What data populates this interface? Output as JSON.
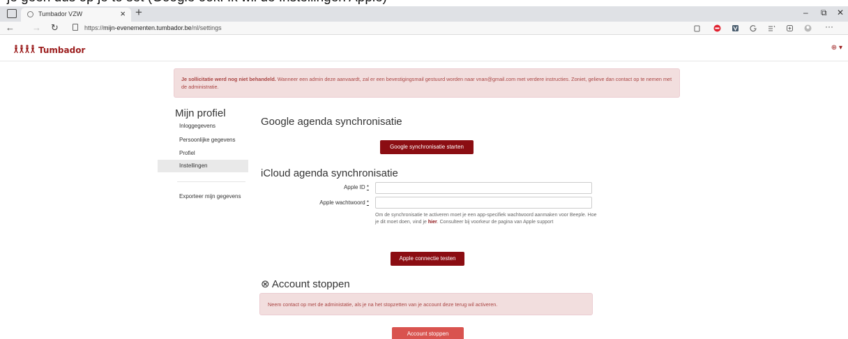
{
  "doc_overlay_text": "je geen dus op je to set (Google ook: Ik wil de Instellingen Apple)",
  "browser": {
    "tab_title": "Tumbador VZW",
    "url_prefix": "https://",
    "url_host": "mijn-evenementen.tumbador.be",
    "url_path": "/nl/settings",
    "icons": [
      "tab-actions-icon",
      "favicon-icon",
      "close-icon",
      "plus-icon",
      "back-icon",
      "forward-icon",
      "refresh-icon",
      "lock-icon",
      "reader-icon",
      "adblock-icon",
      "extension-icon",
      "share-icon",
      "favorites-icon",
      "collections-icon",
      "profile-icon",
      "more-icon"
    ]
  },
  "site": {
    "logo_text": "Tumbador",
    "user_menu_caret": "▾"
  },
  "alert": {
    "bold": "Je sollicitatie werd nog niet behandeld.",
    "text": " Wanneer een admin deze aanvaardt, zal er een bevestigingsmail gestuurd worden naar vnan@gmail.com met verdere instructies. Zoniet, gelieve dan contact op te nemen met de administratie."
  },
  "sidebar": {
    "title": "Mijn profiel",
    "items": [
      {
        "label": "Inloggegevens"
      },
      {
        "label": "Persoonlijke gegevens"
      },
      {
        "label": "Profiel"
      },
      {
        "label": "Instellingen"
      },
      {
        "label": "Exporteer mijn gegevens"
      }
    ]
  },
  "google": {
    "title": "Google agenda synchronisatie",
    "button": "Google synchronisatie starten"
  },
  "icloud": {
    "title": "iCloud agenda synchronisatie",
    "apple_id_label": "Apple ID",
    "password_label": "Apple wachtwoord",
    "required_marker": "*",
    "apple_id_value": "",
    "password_value": "",
    "help_pre": "Om de synchronisatie te activeren moet je een app-specifiek wachtwoord aanmaken voor Beeple. Hoe je dit moet doen, vind je ",
    "help_link": "hier",
    "help_post": ". Consulteer bij voorkeur de pagina van Apple support",
    "button": "Apple connectie testen"
  },
  "account_stop": {
    "icon": "⊗",
    "title": "Account stoppen",
    "notice": "Neem contact op met de administatie, als je na het stopzetten van je account deze terug wil activeren.",
    "button": "Account stoppen"
  },
  "colors": {
    "brand": "#9b1c1c",
    "button_dark": "#8b0d12",
    "button_danger": "#d9534f",
    "alert_bg": "#f2dede",
    "alert_text": "#a94442"
  }
}
